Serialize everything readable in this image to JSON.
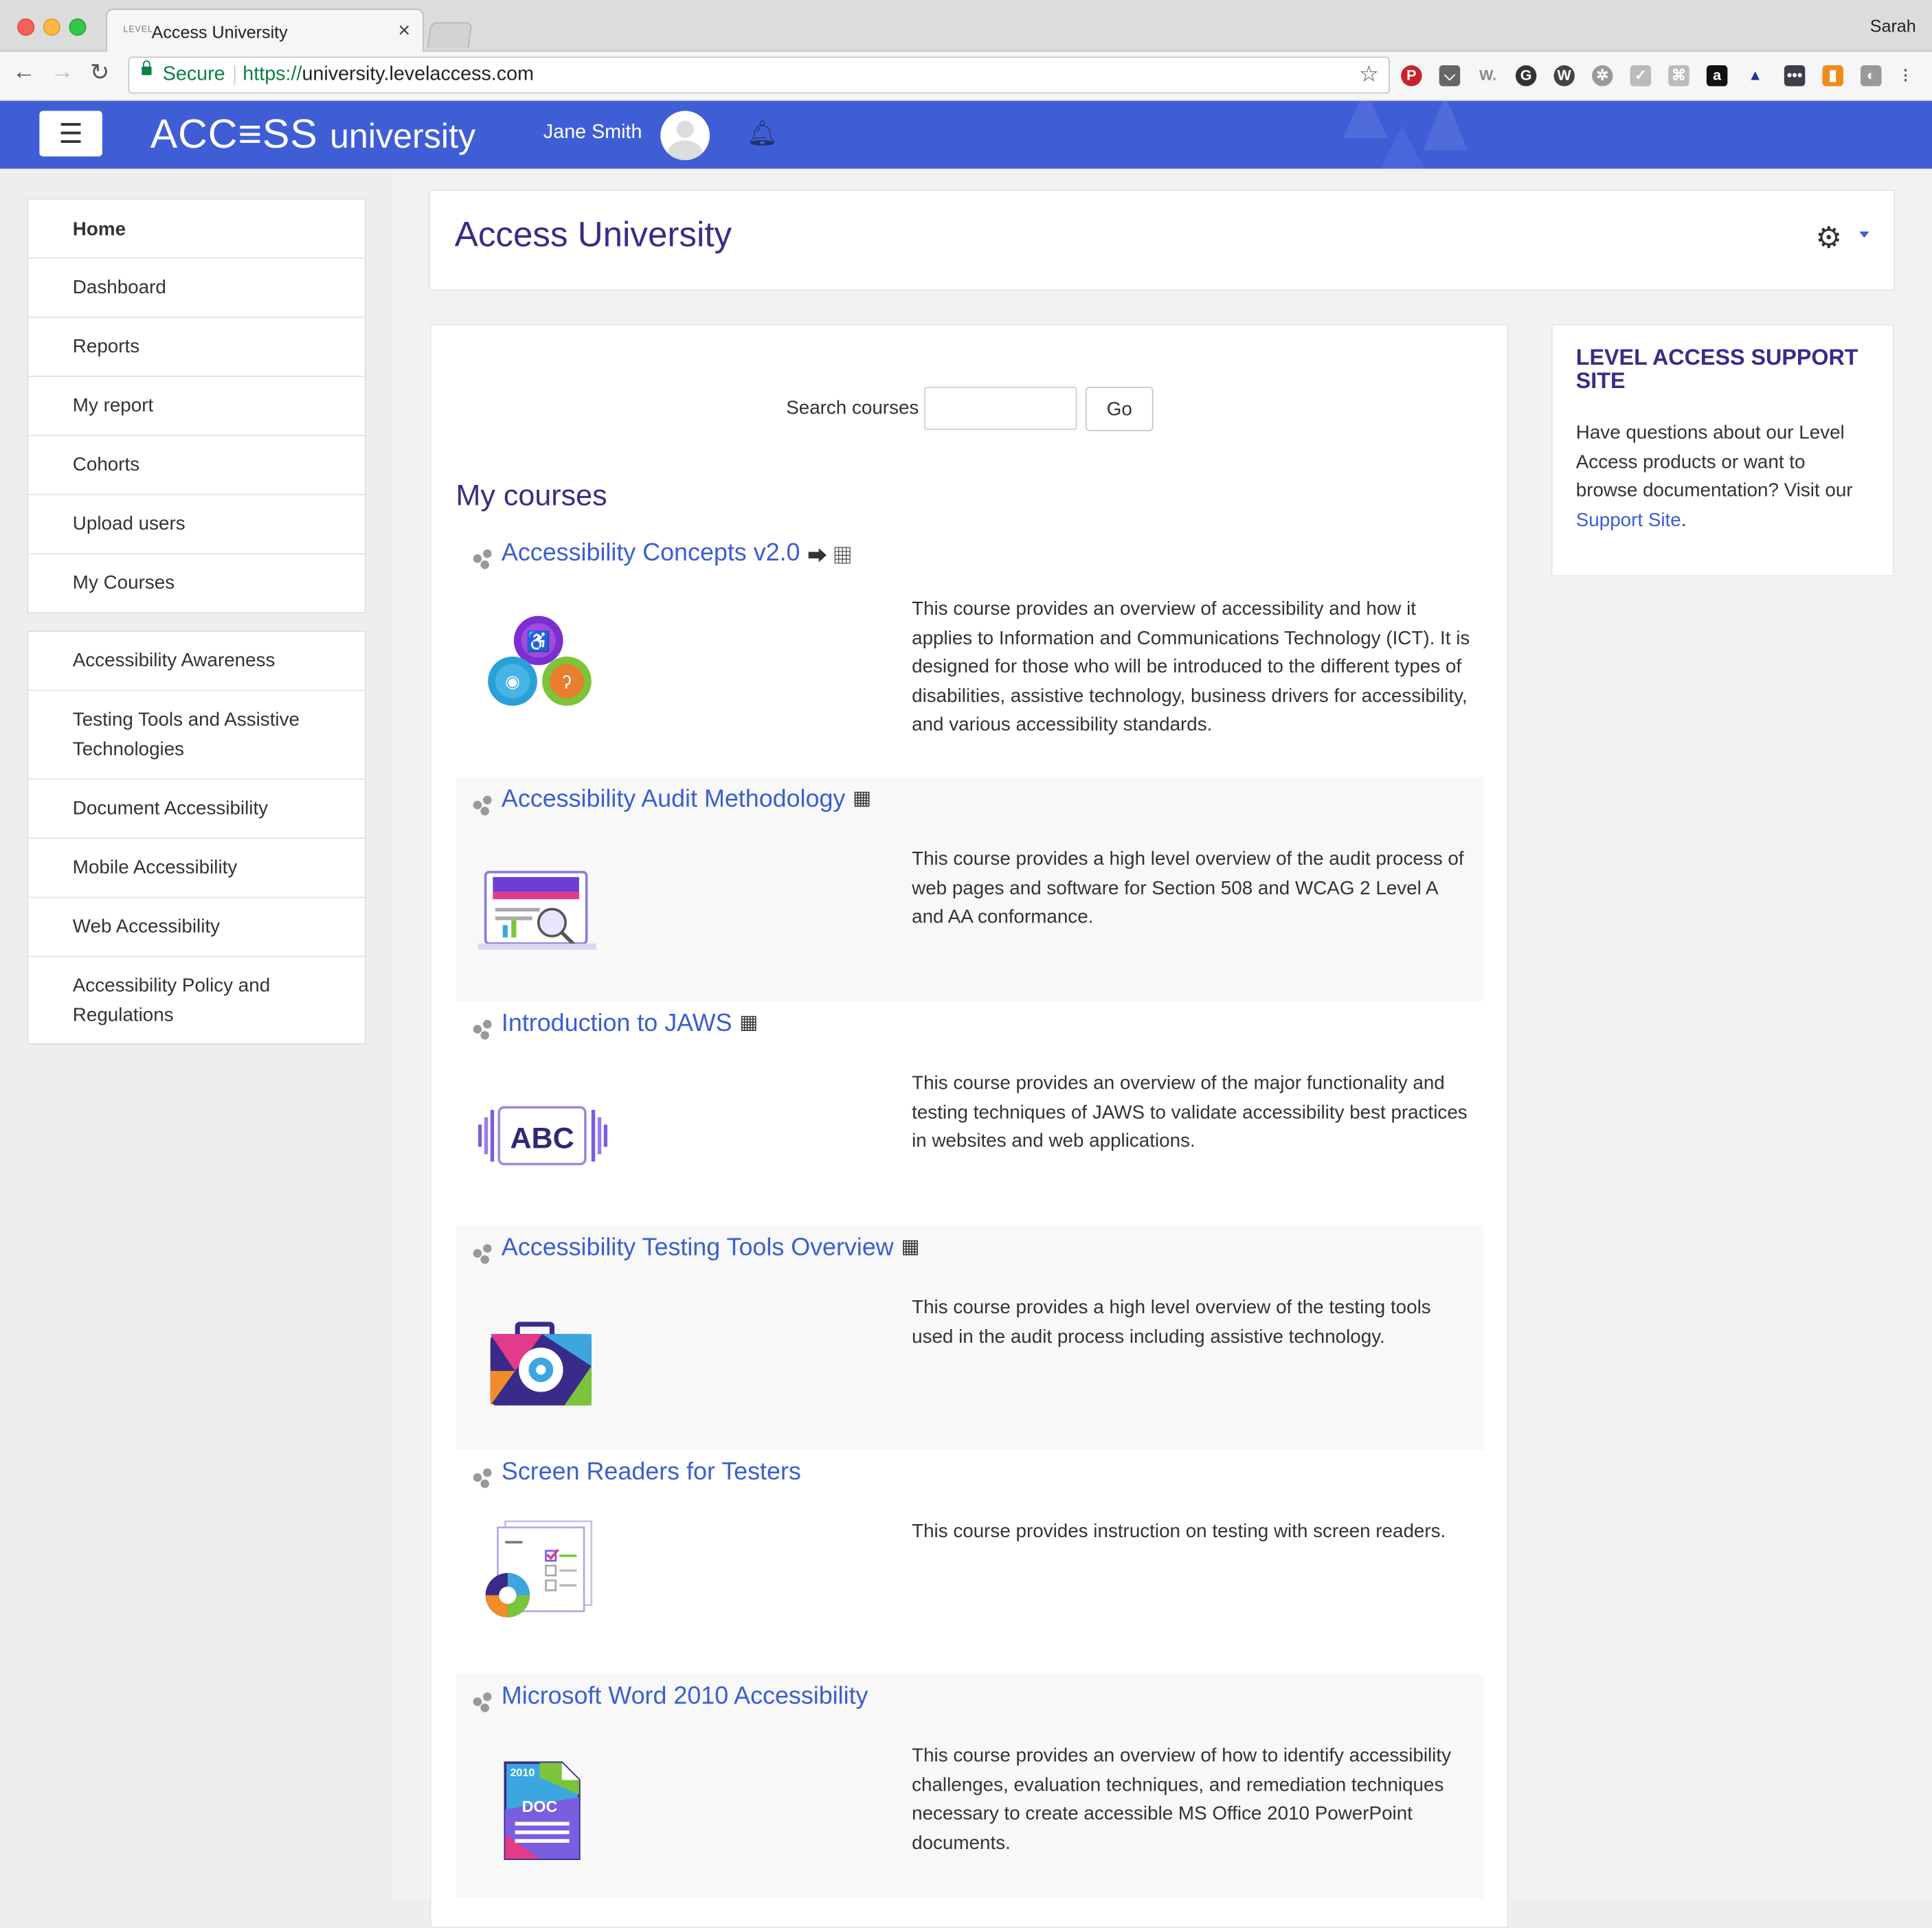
{
  "browser": {
    "tab_title": "Access University",
    "tab_favicon": "LEVEL",
    "profile": "Sarah",
    "secure_label": "Secure",
    "url_scheme": "https://",
    "url_host": "university.levelaccess.com"
  },
  "header": {
    "brand": "ACC≡SS",
    "brand_sub": "university",
    "user_name": "Jane Smith"
  },
  "sidebar": {
    "nav_items": [
      {
        "label": "Home"
      },
      {
        "label": "Dashboard"
      },
      {
        "label": "Reports"
      },
      {
        "label": "My report"
      },
      {
        "label": "Cohorts"
      },
      {
        "label": "Upload users"
      },
      {
        "label": "My Courses"
      }
    ],
    "course_items": [
      {
        "label": "Accessibility Awareness"
      },
      {
        "label": "Testing Tools and Assistive Technologies"
      },
      {
        "label": "Document Accessibility"
      },
      {
        "label": "Mobile Accessibility"
      },
      {
        "label": "Web Accessibility"
      },
      {
        "label": "Accessibility Policy and Regulations"
      }
    ]
  },
  "page": {
    "title": "Access University"
  },
  "search": {
    "label": "Search courses",
    "value": "",
    "go_label": "Go"
  },
  "my_courses": {
    "title": "My courses",
    "courses": [
      {
        "title": "Accessibility Concepts v2.0",
        "icons": "⮕ ▦",
        "desc": "This course provides an overview of accessibility and how it applies to Information and Communications Technology (ICT). It is designed for those who will be introduced to the different types of disabilities, assistive technology, business drivers for accessibility, and various accessibility standards."
      },
      {
        "title": "Accessibility Audit Methodology",
        "icons": "▦",
        "desc": "This course provides a high level overview of the audit process of web pages and software for Section 508 and WCAG 2 Level A and AA conformance."
      },
      {
        "title": "Introduction to JAWS",
        "icons": "▦",
        "image_text": "ABC",
        "desc": "This course provides an overview of the major functionality and testing techniques of JAWS to validate accessibility best practices in websites and web applications."
      },
      {
        "title": "Accessibility Testing Tools Overview",
        "icons": "▦",
        "desc": "This course provides a high level overview of the testing tools used in the audit process including assistive technology."
      },
      {
        "title": "Screen Readers for Testers",
        "icons": "",
        "desc": "This course provides instruction on testing with screen readers."
      },
      {
        "title": "Microsoft Word 2010 Accessibility",
        "icons": "",
        "image_text": "2010",
        "image_text2": "DOC",
        "desc": "This course provides an overview of how to identify accessibility challenges, evaluation techniques, and remediation techniques necessary to create accessible MS Office 2010 PowerPoint documents."
      }
    ]
  },
  "support": {
    "title": "LEVEL ACCESS SUPPORT SITE",
    "text": "Have questions about our Level Access products or want to browse documentation? Visit our ",
    "link": "Support Site",
    "after": "."
  }
}
